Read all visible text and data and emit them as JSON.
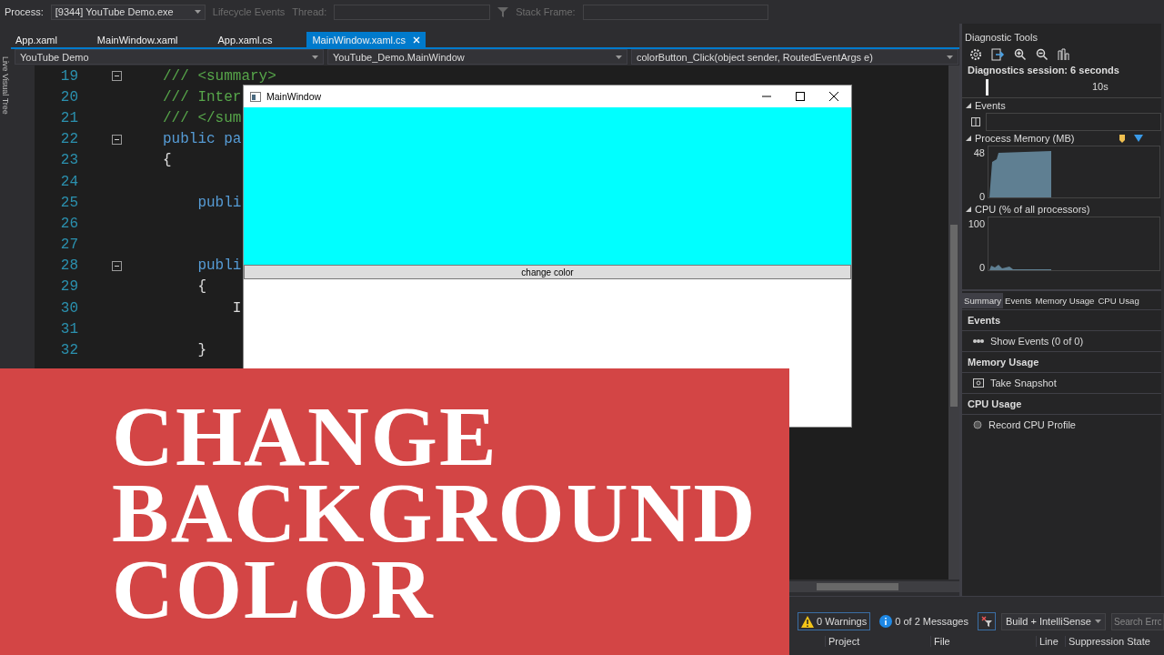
{
  "toolbar": {
    "process_label": "Process:",
    "process_value": "[9344] YouTube Demo.exe",
    "lifecycle": "Lifecycle Events",
    "thread_label": "Thread:",
    "stack_label": "Stack Frame:"
  },
  "side_strip": {
    "label": "Live Visual Tree"
  },
  "editor": {
    "tabs": [
      {
        "label": "App.xaml",
        "selected": false
      },
      {
        "label": "MainWindow.xaml",
        "selected": false
      },
      {
        "label": "App.xaml.cs",
        "selected": false
      },
      {
        "label": "MainWindow.xaml.cs",
        "selected": true
      }
    ],
    "nav": [
      "YouTube Demo",
      "YouTube_Demo.MainWindow",
      "colorButton_Click(object sender, RoutedEventArgs e)"
    ],
    "lines": [
      {
        "number": "19",
        "fold": true,
        "kind": "comment",
        "text": "/// <summary>"
      },
      {
        "number": "20",
        "fold": false,
        "kind": "comment",
        "text": "/// Inter"
      },
      {
        "number": "21",
        "fold": false,
        "kind": "comment",
        "text": "/// </sum"
      },
      {
        "number": "22",
        "fold": true,
        "kind": "keyword",
        "text": "public pa"
      },
      {
        "number": "23",
        "fold": false,
        "kind": "plain",
        "text": "{"
      },
      {
        "number": "24",
        "fold": false
      },
      {
        "number": "25",
        "fold": false,
        "kind": "keyword",
        "text": "    publi"
      },
      {
        "number": "26",
        "fold": false
      },
      {
        "number": "27",
        "fold": false
      },
      {
        "number": "28",
        "fold": true,
        "kind": "keyword",
        "text": "    publi"
      },
      {
        "number": "29",
        "fold": false,
        "kind": "plain",
        "text": "    {"
      },
      {
        "number": "30",
        "fold": false,
        "kind": "plain",
        "text": "        I"
      },
      {
        "number": "31",
        "fold": false
      },
      {
        "number": "32",
        "fold": false,
        "kind": "plain",
        "text": "    }"
      }
    ]
  },
  "app_window": {
    "title": "MainWindow",
    "button": "change color"
  },
  "diagnostics": {
    "title": "Diagnostic Tools",
    "session": "Diagnostics session: 6 seconds",
    "ruler": "10s",
    "events_header": "Events",
    "memory_header": "Process Memory (MB)",
    "memory_ticks": [
      "48",
      "0"
    ],
    "cpu_header": "CPU (% of all processors)",
    "cpu_ticks": [
      "100",
      "0"
    ],
    "tabs": [
      {
        "label": "Summary",
        "selected": true
      },
      {
        "label": "Events",
        "selected": false
      },
      {
        "label": "Memory Usage",
        "selected": false
      },
      {
        "label": "CPU Usag",
        "selected": false
      }
    ],
    "sections": [
      {
        "title": "Events",
        "action": "Show Events (0 of 0)",
        "kind": "events"
      },
      {
        "title": "Memory Usage",
        "action": "Take Snapshot",
        "kind": "snapshot"
      },
      {
        "title": "CPU Usage",
        "action": "Record CPU Profile",
        "kind": "record"
      }
    ]
  },
  "error_list": {
    "warnings": "0 Warnings",
    "messages": "0 of 2 Messages",
    "scope": "Build + IntelliSense",
    "search_placeholder": "Search Erro",
    "columns": [
      "Project",
      "File",
      "Line",
      "Suppression State"
    ]
  },
  "banner": {
    "text": "CHANGE BACKGROUND COLOR"
  }
}
